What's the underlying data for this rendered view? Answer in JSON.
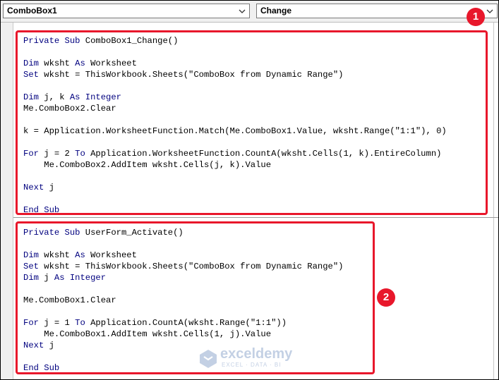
{
  "toolbar": {
    "object_value": "ComboBox1",
    "procedure_value": "Change"
  },
  "code_lines": [
    {
      "spans": [
        {
          "t": "Private Sub",
          "k": true
        },
        {
          "t": " ComboBox1_Change()"
        }
      ]
    },
    {
      "spans": []
    },
    {
      "spans": [
        {
          "t": "Dim",
          "k": true
        },
        {
          "t": " wksht "
        },
        {
          "t": "As",
          "k": true
        },
        {
          "t": " Worksheet"
        }
      ]
    },
    {
      "spans": [
        {
          "t": "Set",
          "k": true
        },
        {
          "t": " wksht = ThisWorkbook.Sheets(\"ComboBox from Dynamic Range\")"
        }
      ]
    },
    {
      "spans": []
    },
    {
      "spans": [
        {
          "t": "Dim",
          "k": true
        },
        {
          "t": " j, k "
        },
        {
          "t": "As Integer",
          "k": true
        }
      ]
    },
    {
      "spans": [
        {
          "t": "Me.ComboBox2.Clear"
        }
      ]
    },
    {
      "spans": []
    },
    {
      "spans": [
        {
          "t": "k = Application.WorksheetFunction.Match(Me.ComboBox1.Value, wksht.Range(\"1:1\"), 0)"
        }
      ]
    },
    {
      "spans": []
    },
    {
      "spans": [
        {
          "t": "For",
          "k": true
        },
        {
          "t": " j = 2 "
        },
        {
          "t": "To",
          "k": true
        },
        {
          "t": " Application.WorksheetFunction.CountA(wksht.Cells(1, k).EntireColumn)"
        }
      ]
    },
    {
      "spans": [
        {
          "t": "    Me.ComboBox2.AddItem wksht.Cells(j, k).Value"
        }
      ]
    },
    {
      "spans": []
    },
    {
      "spans": [
        {
          "t": "Next",
          "k": true
        },
        {
          "t": " j"
        }
      ]
    },
    {
      "spans": []
    },
    {
      "spans": [
        {
          "t": "End Sub",
          "k": true
        }
      ]
    },
    {
      "spans": [
        {
          "t": "Private Sub",
          "k": true
        },
        {
          "t": " UserForm_Activate()"
        }
      ]
    },
    {
      "spans": []
    },
    {
      "spans": [
        {
          "t": "Dim",
          "k": true
        },
        {
          "t": " wksht "
        },
        {
          "t": "As",
          "k": true
        },
        {
          "t": " Worksheet"
        }
      ]
    },
    {
      "spans": [
        {
          "t": "Set",
          "k": true
        },
        {
          "t": " wksht = ThisWorkbook.Sheets(\"ComboBox from Dynamic Range\")"
        }
      ]
    },
    {
      "spans": [
        {
          "t": "Dim",
          "k": true
        },
        {
          "t": " j "
        },
        {
          "t": "As Integer",
          "k": true
        }
      ]
    },
    {
      "spans": []
    },
    {
      "spans": [
        {
          "t": "Me.ComboBox1.Clear"
        }
      ]
    },
    {
      "spans": []
    },
    {
      "spans": [
        {
          "t": "For",
          "k": true
        },
        {
          "t": " j = 1 "
        },
        {
          "t": "To",
          "k": true
        },
        {
          "t": " Application.CountA(wksht.Range(\"1:1\"))"
        }
      ]
    },
    {
      "spans": [
        {
          "t": "    Me.ComboBox1.AddItem wksht.Cells(1, j).Value"
        }
      ]
    },
    {
      "spans": [
        {
          "t": "Next",
          "k": true
        },
        {
          "t": " j"
        }
      ]
    },
    {
      "spans": []
    },
    {
      "spans": [
        {
          "t": "End Sub",
          "k": true
        }
      ]
    }
  ],
  "annotations": {
    "badge1": "1",
    "badge2": "2"
  },
  "watermark": {
    "name": "exceldemy",
    "tagline": "EXCEL · DATA · BI"
  },
  "colors": {
    "keyword": "#00007f",
    "highlight": "#e8172b",
    "watermark": "#2d5aa0"
  },
  "icons": {
    "dropdown": "chevron-down-icon",
    "logo": "exceldemy-logo-icon"
  }
}
